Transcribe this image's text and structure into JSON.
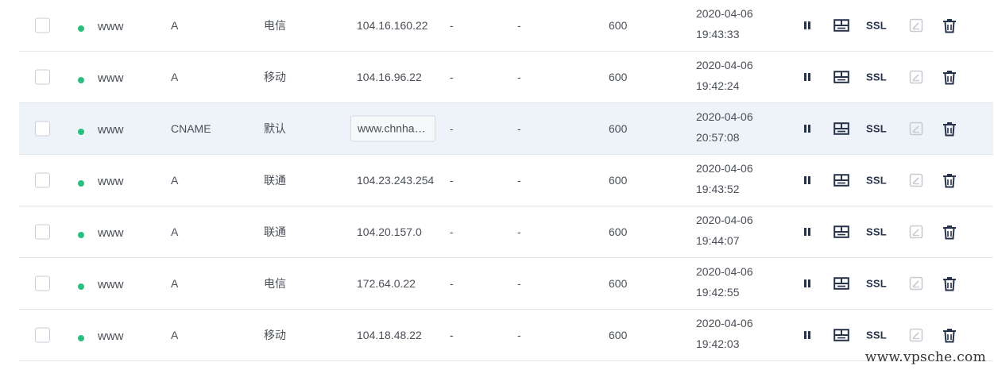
{
  "colors": {
    "status_dot": "#2bbf7f",
    "icon_dark": "#27334a",
    "icon_disabled": "#c8ccd2",
    "highlight_row": "#eef2f9"
  },
  "icons": {
    "pause": "pause-icon",
    "split": "split-view-icon",
    "edit": "edit-icon",
    "delete": "trash-icon"
  },
  "actions": {
    "ssl_label": "SSL"
  },
  "rows": [
    {
      "host": "www",
      "type": "A",
      "line": "电信",
      "value": "104.16.160.22",
      "weight": "-",
      "mx": "-",
      "ttl": "600",
      "date": "2020-04-06",
      "time": "19:43:33",
      "highlighted": false
    },
    {
      "host": "www",
      "type": "A",
      "line": "移动",
      "value": "104.16.96.22",
      "weight": "-",
      "mx": "-",
      "ttl": "600",
      "date": "2020-04-06",
      "time": "19:42:24",
      "highlighted": false
    },
    {
      "host": "www",
      "type": "CNAME",
      "line": "默认",
      "value": "www.chnham....",
      "weight": "-",
      "mx": "-",
      "ttl": "600",
      "date": "2020-04-06",
      "time": "20:57:08",
      "highlighted": true
    },
    {
      "host": "www",
      "type": "A",
      "line": "联通",
      "value": "104.23.243.254",
      "weight": "-",
      "mx": "-",
      "ttl": "600",
      "date": "2020-04-06",
      "time": "19:43:52",
      "highlighted": false
    },
    {
      "host": "www",
      "type": "A",
      "line": "联通",
      "value": "104.20.157.0",
      "weight": "-",
      "mx": "-",
      "ttl": "600",
      "date": "2020-04-06",
      "time": "19:44:07",
      "highlighted": false
    },
    {
      "host": "www",
      "type": "A",
      "line": "电信",
      "value": "172.64.0.22",
      "weight": "-",
      "mx": "-",
      "ttl": "600",
      "date": "2020-04-06",
      "time": "19:42:55",
      "highlighted": false
    },
    {
      "host": "www",
      "type": "A",
      "line": "移动",
      "value": "104.18.48.22",
      "weight": "-",
      "mx": "-",
      "ttl": "600",
      "date": "2020-04-06",
      "time": "19:42:03",
      "highlighted": false
    }
  ],
  "watermark": "www.vpsche.com"
}
